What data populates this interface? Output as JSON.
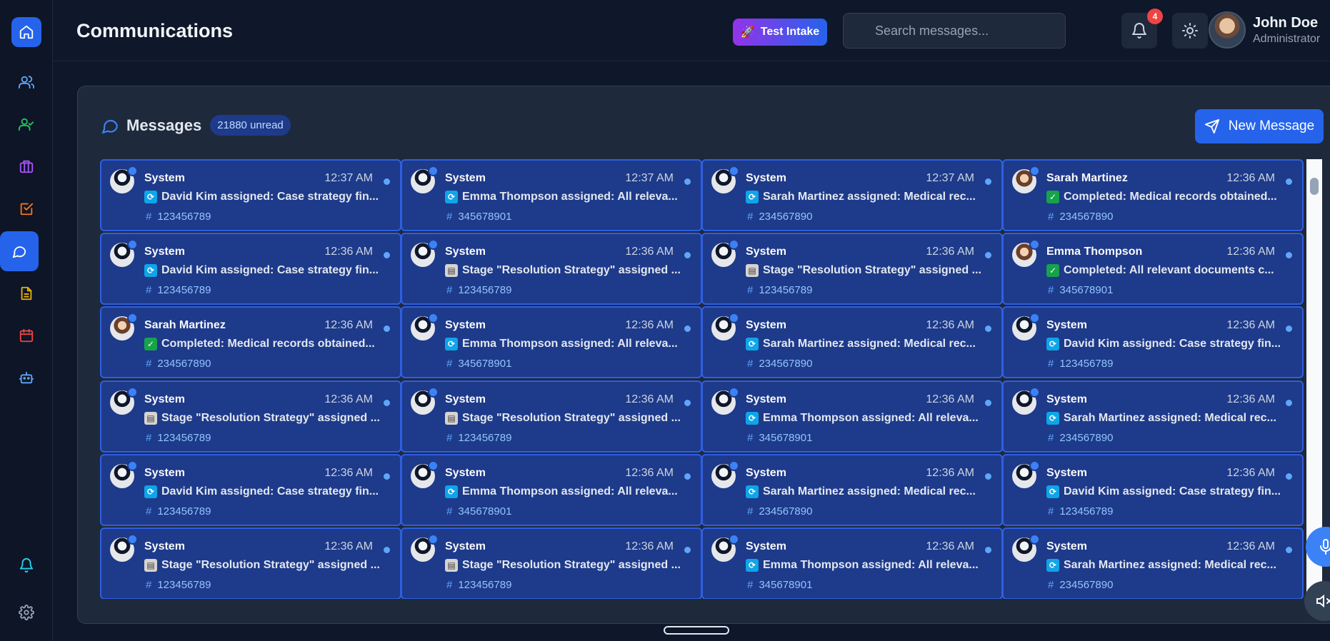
{
  "nav": {
    "home": "home-icon",
    "items": [
      "users-icon",
      "user-check-icon",
      "briefcase-icon",
      "checklist-icon",
      "chat-icon",
      "document-icon",
      "calendar-icon",
      "bot-icon"
    ],
    "bottom": [
      "bell-icon",
      "gear-icon"
    ]
  },
  "header": {
    "title": "Communications",
    "test_intake": "Test Intake",
    "search_placeholder": "Search messages...",
    "notifications_count": "4",
    "user_name": "John Doe",
    "user_role": "Administrator"
  },
  "panel": {
    "title": "Messages",
    "unread": "21880 unread",
    "new_message": "New Message"
  },
  "colors": {
    "accent": "#2563eb",
    "card_bg": "#1e3a8a",
    "card_border": "#2f5fe0",
    "unread_dot": "#60a5fa"
  },
  "messages": [
    {
      "sender": "System",
      "time": "12:37 AM",
      "icon": "sync",
      "subject": "David Kim assigned: Case strategy fin...",
      "case": "123456789",
      "avatar": "male"
    },
    {
      "sender": "System",
      "time": "12:37 AM",
      "icon": "sync",
      "subject": "Emma Thompson assigned: All releva...",
      "case": "345678901",
      "avatar": "male"
    },
    {
      "sender": "System",
      "time": "12:37 AM",
      "icon": "sync",
      "subject": "Sarah Martinez assigned: Medical rec...",
      "case": "234567890",
      "avatar": "male"
    },
    {
      "sender": "Sarah Martinez",
      "time": "12:36 AM",
      "icon": "done",
      "subject": "Completed: Medical records obtained...",
      "case": "234567890",
      "avatar": "female"
    },
    {
      "sender": "System",
      "time": "12:36 AM",
      "icon": "sync",
      "subject": "David Kim assigned: Case strategy fin...",
      "case": "123456789",
      "avatar": "male"
    },
    {
      "sender": "System",
      "time": "12:36 AM",
      "icon": "clip",
      "subject": "Stage \"Resolution Strategy\" assigned ...",
      "case": "123456789",
      "avatar": "male"
    },
    {
      "sender": "System",
      "time": "12:36 AM",
      "icon": "clip",
      "subject": "Stage \"Resolution Strategy\" assigned ...",
      "case": "123456789",
      "avatar": "male"
    },
    {
      "sender": "Emma Thompson",
      "time": "12:36 AM",
      "icon": "done",
      "subject": "Completed: All relevant documents c...",
      "case": "345678901",
      "avatar": "female"
    },
    {
      "sender": "Sarah Martinez",
      "time": "12:36 AM",
      "icon": "done",
      "subject": "Completed: Medical records obtained...",
      "case": "234567890",
      "avatar": "female"
    },
    {
      "sender": "System",
      "time": "12:36 AM",
      "icon": "sync",
      "subject": "Emma Thompson assigned: All releva...",
      "case": "345678901",
      "avatar": "male"
    },
    {
      "sender": "System",
      "time": "12:36 AM",
      "icon": "sync",
      "subject": "Sarah Martinez assigned: Medical rec...",
      "case": "234567890",
      "avatar": "male"
    },
    {
      "sender": "System",
      "time": "12:36 AM",
      "icon": "sync",
      "subject": "David Kim assigned: Case strategy fin...",
      "case": "123456789",
      "avatar": "male"
    },
    {
      "sender": "System",
      "time": "12:36 AM",
      "icon": "clip",
      "subject": "Stage \"Resolution Strategy\" assigned ...",
      "case": "123456789",
      "avatar": "male"
    },
    {
      "sender": "System",
      "time": "12:36 AM",
      "icon": "clip",
      "subject": "Stage \"Resolution Strategy\" assigned ...",
      "case": "123456789",
      "avatar": "male"
    },
    {
      "sender": "System",
      "time": "12:36 AM",
      "icon": "sync",
      "subject": "Emma Thompson assigned: All releva...",
      "case": "345678901",
      "avatar": "male"
    },
    {
      "sender": "System",
      "time": "12:36 AM",
      "icon": "sync",
      "subject": "Sarah Martinez assigned: Medical rec...",
      "case": "234567890",
      "avatar": "male"
    },
    {
      "sender": "System",
      "time": "12:36 AM",
      "icon": "sync",
      "subject": "David Kim assigned: Case strategy fin...",
      "case": "123456789",
      "avatar": "male"
    },
    {
      "sender": "System",
      "time": "12:36 AM",
      "icon": "sync",
      "subject": "Emma Thompson assigned: All releva...",
      "case": "345678901",
      "avatar": "male"
    },
    {
      "sender": "System",
      "time": "12:36 AM",
      "icon": "sync",
      "subject": "Sarah Martinez assigned: Medical rec...",
      "case": "234567890",
      "avatar": "male"
    },
    {
      "sender": "System",
      "time": "12:36 AM",
      "icon": "sync",
      "subject": "David Kim assigned: Case strategy fin...",
      "case": "123456789",
      "avatar": "male"
    },
    {
      "sender": "System",
      "time": "12:36 AM",
      "icon": "clip",
      "subject": "Stage \"Resolution Strategy\" assigned ...",
      "case": "123456789",
      "avatar": "male"
    },
    {
      "sender": "System",
      "time": "12:36 AM",
      "icon": "clip",
      "subject": "Stage \"Resolution Strategy\" assigned ...",
      "case": "123456789",
      "avatar": "male"
    },
    {
      "sender": "System",
      "time": "12:36 AM",
      "icon": "sync",
      "subject": "Emma Thompson assigned: All releva...",
      "case": "345678901",
      "avatar": "male"
    },
    {
      "sender": "System",
      "time": "12:36 AM",
      "icon": "sync",
      "subject": "Sarah Martinez assigned: Medical rec...",
      "case": "234567890",
      "avatar": "male"
    }
  ]
}
